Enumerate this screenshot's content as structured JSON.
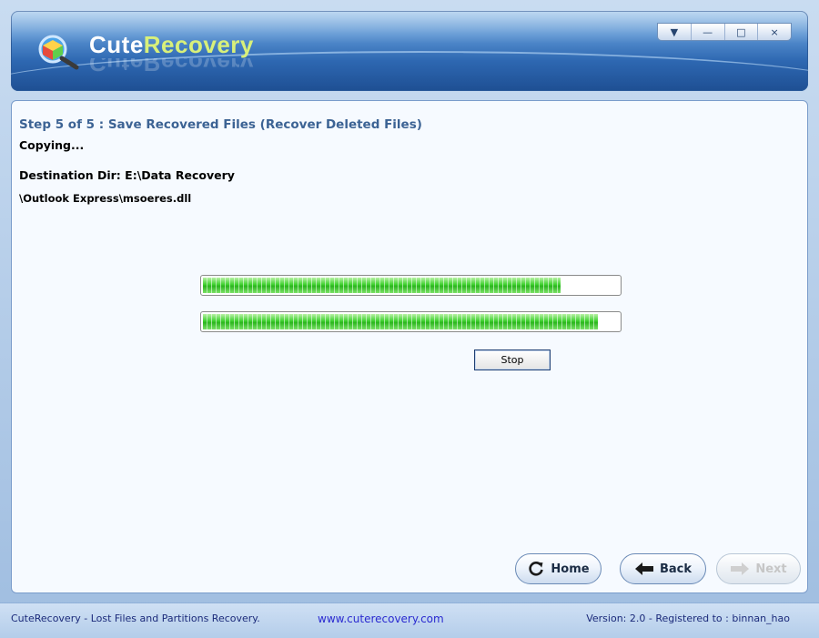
{
  "app": {
    "name_part1": "Cute",
    "name_part2": "Recovery",
    "reflection": "CuteRecovery"
  },
  "window_controls": {
    "menu": "▼",
    "minimize": "—",
    "maximize": "□",
    "close": "×"
  },
  "main": {
    "step_title": "Step 5 of 5 : Save Recovered Files (Recover Deleted Files)",
    "status": "Copying...",
    "destination_label": "Destination Dir:",
    "destination_value": "E:\\Data Recovery",
    "current_file": "\\Outlook Express\\msoeres.dll",
    "progress_file_pct": 86,
    "progress_total_pct": 95,
    "stop_label": "Stop"
  },
  "nav": {
    "home_label": "Home",
    "back_label": "Back",
    "next_label": "Next"
  },
  "footer": {
    "left": "CuteRecovery - Lost Files and Partitions Recovery.",
    "url": "www.cuterecovery.com",
    "right": "Version: 2.0 - Registered to : binnan_hao"
  }
}
